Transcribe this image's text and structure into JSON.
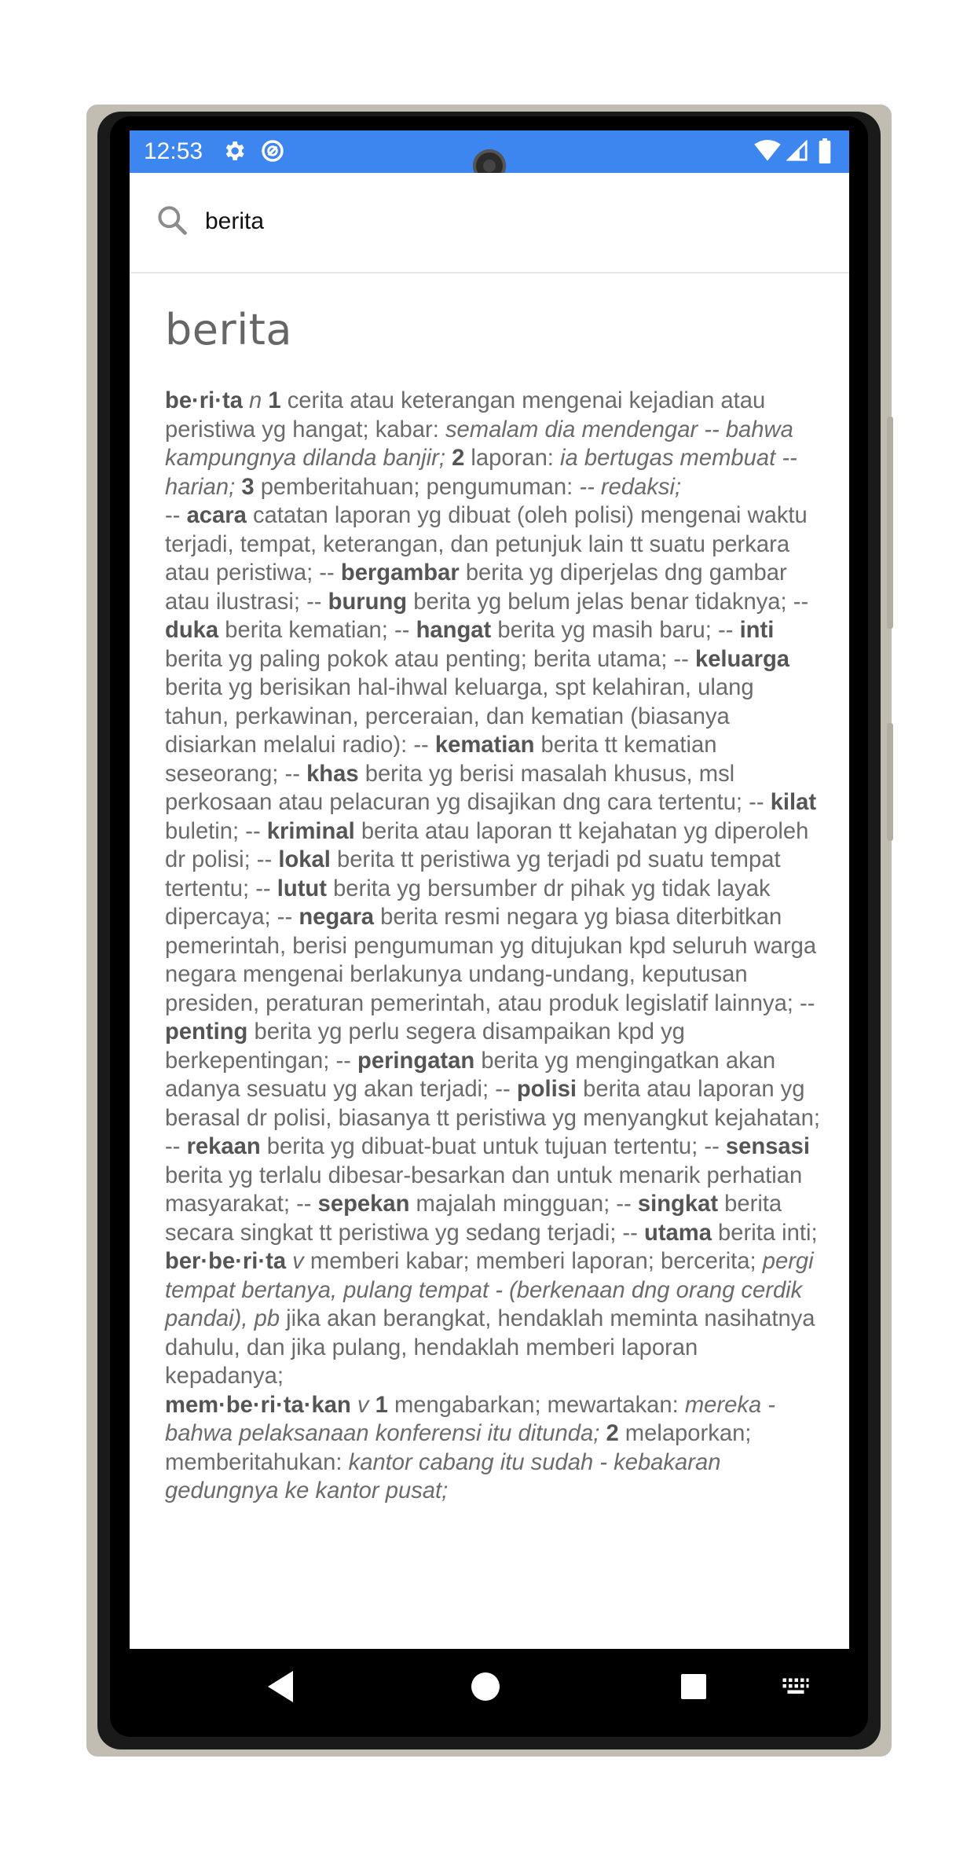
{
  "status_bar": {
    "time": "12:53",
    "left_icons": [
      "gear-icon",
      "data-saver-icon"
    ],
    "right_icons": [
      "wifi-icon",
      "signal-icon",
      "battery-icon"
    ],
    "color": "#3d85ef"
  },
  "search": {
    "query": "berita",
    "icon": "search-icon"
  },
  "entry": {
    "title": "berita"
  },
  "definition_segments": [
    {
      "t": "be·ri·ta",
      "s": "b"
    },
    {
      "t": " "
    },
    {
      "t": "n",
      "s": "i"
    },
    {
      "t": " "
    },
    {
      "t": "1",
      "s": "b"
    },
    {
      "t": " cerita atau keterangan mengenai kejadian atau peristiwa yg hangat; kabar: "
    },
    {
      "t": "semalam dia mendengar -- bahwa kampungnya dilanda banjir;",
      "s": "i"
    },
    {
      "t": " "
    },
    {
      "t": "2",
      "s": "b"
    },
    {
      "t": " laporan: "
    },
    {
      "t": "ia bertugas membuat -- harian;",
      "s": "i"
    },
    {
      "t": " "
    },
    {
      "t": "3",
      "s": "b"
    },
    {
      "t": " pemberitahuan; pengumuman: "
    },
    {
      "t": "-- redaksi;",
      "s": "i"
    },
    {
      "t": "",
      "s": "br"
    },
    {
      "t": "-- "
    },
    {
      "t": "acara",
      "s": "b"
    },
    {
      "t": " catatan laporan yg dibuat (oleh polisi) mengenai waktu terjadi, tempat, keterangan, dan petunjuk lain tt suatu perkara atau peristiwa; -- "
    },
    {
      "t": "bergambar",
      "s": "b"
    },
    {
      "t": " berita yg diperjelas dng gambar atau ilustrasi; -- "
    },
    {
      "t": "burung",
      "s": "b"
    },
    {
      "t": " berita yg belum jelas benar tidaknya; -- "
    },
    {
      "t": "duka",
      "s": "b"
    },
    {
      "t": " berita kematian; -- "
    },
    {
      "t": "hangat",
      "s": "b"
    },
    {
      "t": " berita yg masih baru; -- "
    },
    {
      "t": "inti",
      "s": "b"
    },
    {
      "t": " berita yg paling pokok atau penting; berita utama; -- "
    },
    {
      "t": "keluarga",
      "s": "b"
    },
    {
      "t": " berita yg berisikan hal-ihwal keluarga, spt kelahiran, ulang tahun, perkawinan, perceraian, dan kematian (biasanya disiarkan melalui radio): -- "
    },
    {
      "t": "kematian",
      "s": "b"
    },
    {
      "t": " berita tt kematian seseorang; -- "
    },
    {
      "t": "khas",
      "s": "b"
    },
    {
      "t": " berita yg berisi masalah khusus, msl perkosaan atau pelacuran yg disajikan dng cara tertentu; -- "
    },
    {
      "t": "kilat",
      "s": "b"
    },
    {
      "t": " buletin; -- "
    },
    {
      "t": "kriminal",
      "s": "b"
    },
    {
      "t": " berita atau laporan tt kejahatan yg diperoleh dr polisi; -- "
    },
    {
      "t": "lokal",
      "s": "b"
    },
    {
      "t": " berita tt peristiwa yg terjadi pd suatu tempat tertentu; -- "
    },
    {
      "t": "lutut",
      "s": "b"
    },
    {
      "t": " berita yg bersumber dr pihak yg tidak layak dipercaya; -- "
    },
    {
      "t": "negara",
      "s": "b"
    },
    {
      "t": " berita resmi negara yg biasa diterbitkan pemerintah, berisi pengumuman yg ditujukan kpd seluruh warga negara mengenai berlakunya undang-undang, keputusan presiden, peraturan pemerintah, atau produk legislatif lainnya; -- "
    },
    {
      "t": "penting",
      "s": "b"
    },
    {
      "t": " berita yg perlu segera disampaikan kpd yg berkepentingan; -- "
    },
    {
      "t": "peringatan",
      "s": "b"
    },
    {
      "t": " berita yg mengingatkan akan adanya sesuatu yg akan terjadi; -- "
    },
    {
      "t": "polisi",
      "s": "b"
    },
    {
      "t": " berita atau laporan yg berasal dr polisi, biasanya tt peristiwa yg menyangkut kejahatan; -- "
    },
    {
      "t": "rekaan",
      "s": "b"
    },
    {
      "t": " berita yg dibuat-buat untuk tujuan tertentu; -- "
    },
    {
      "t": "sensasi",
      "s": "b"
    },
    {
      "t": " berita yg terlalu dibesar-besarkan dan untuk menarik perhatian masyarakat; -- "
    },
    {
      "t": "sepekan",
      "s": "b"
    },
    {
      "t": " majalah mingguan; -- "
    },
    {
      "t": "singkat",
      "s": "b"
    },
    {
      "t": " berita secara singkat tt peristiwa yg sedang terjadi; -- "
    },
    {
      "t": "utama",
      "s": "b"
    },
    {
      "t": " berita inti;"
    },
    {
      "t": "",
      "s": "br"
    },
    {
      "t": "ber·be·ri·ta",
      "s": "b"
    },
    {
      "t": " "
    },
    {
      "t": "v",
      "s": "i"
    },
    {
      "t": " memberi kabar; memberi laporan; bercerita; "
    },
    {
      "t": "pergi tempat bertanya, pulang tempat - (berkenaan dng orang cerdik pandai), pb",
      "s": "i"
    },
    {
      "t": " jika akan berangkat, hendaklah meminta nasihatnya dahulu, dan jika pulang, hendaklah memberi laporan kepadanya;"
    },
    {
      "t": "",
      "s": "br"
    },
    {
      "t": "mem·be·ri·ta·kan",
      "s": "b"
    },
    {
      "t": " "
    },
    {
      "t": "v",
      "s": "i"
    },
    {
      "t": " "
    },
    {
      "t": "1",
      "s": "b"
    },
    {
      "t": " mengabarkan; mewartakan: "
    },
    {
      "t": "mereka - bahwa pelaksanaan konferensi itu ditunda;",
      "s": "i"
    },
    {
      "t": " "
    },
    {
      "t": "2",
      "s": "b"
    },
    {
      "t": " melaporkan; memberitahukan: "
    },
    {
      "t": "kantor cabang itu sudah - kebakaran gedungnya ke kantor pusat;",
      "s": "i"
    }
  ],
  "nav_bar": {
    "buttons": [
      "back-icon",
      "home-icon",
      "recents-icon",
      "keyboard-icon"
    ]
  }
}
